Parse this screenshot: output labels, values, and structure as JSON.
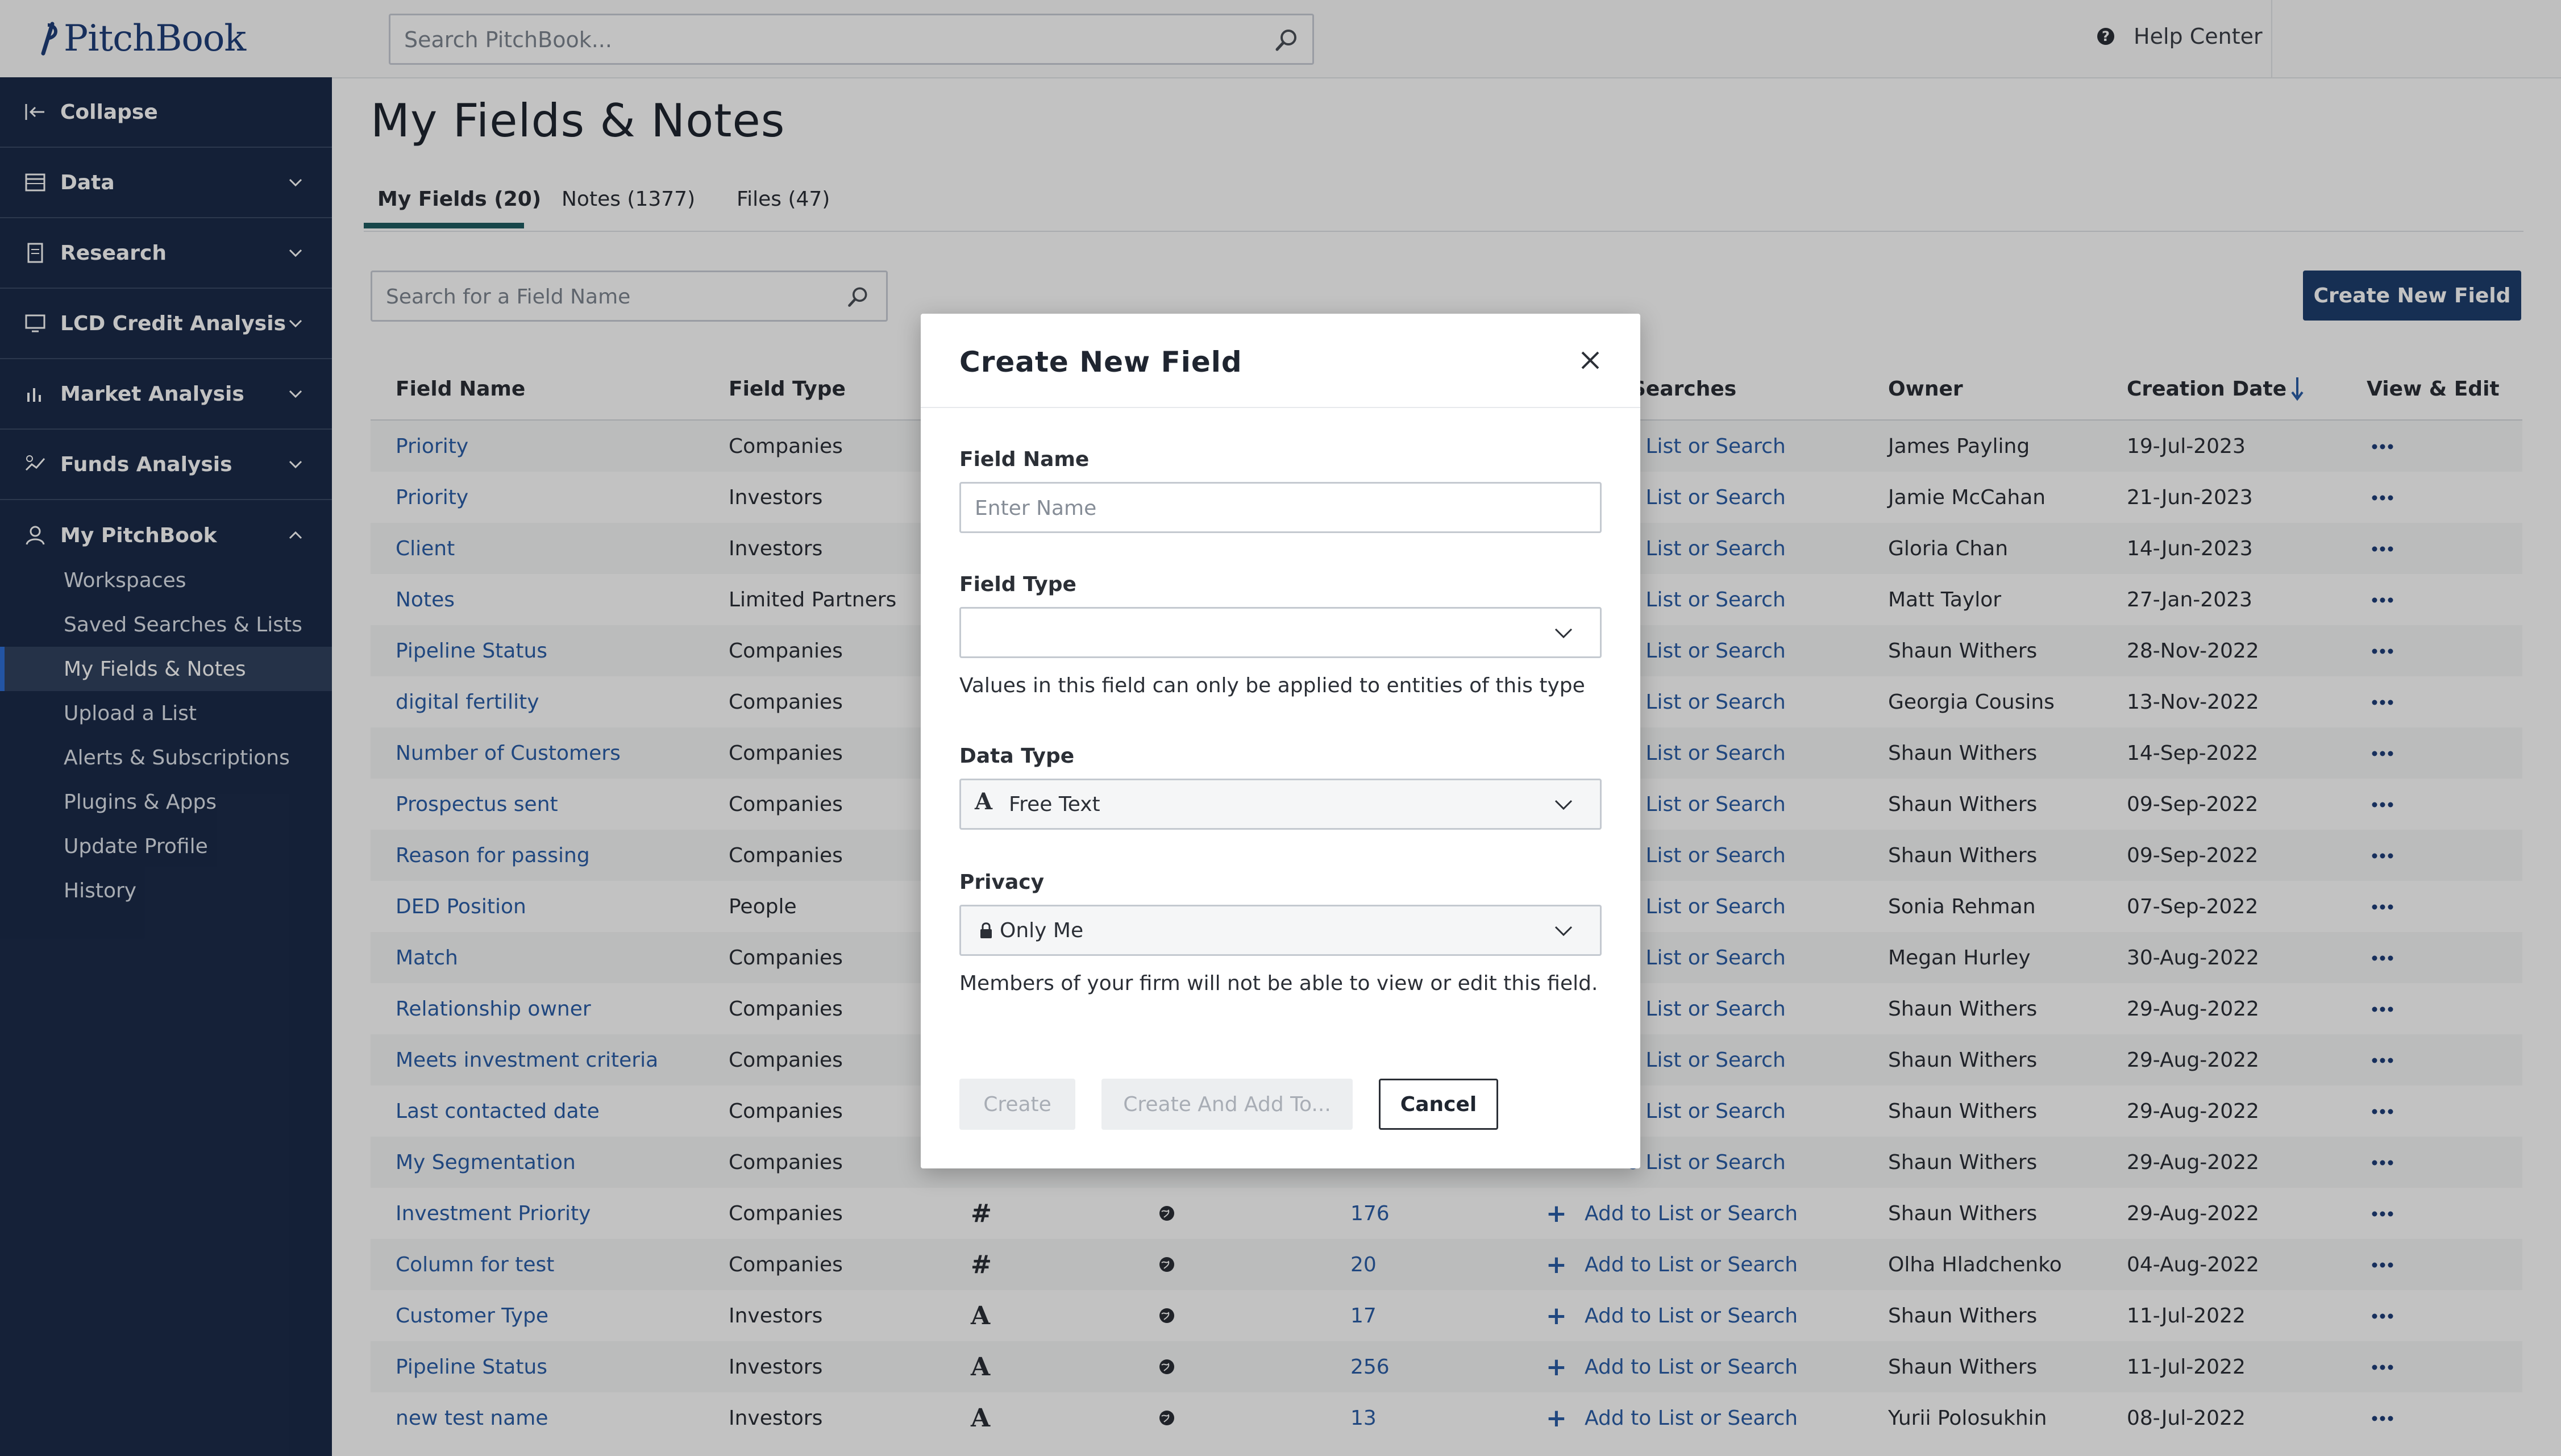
{
  "app": {
    "logo": "PitchBook"
  },
  "header": {
    "search_placeholder": "Search PitchBook...",
    "help_label": "Help Center"
  },
  "sidebar": {
    "collapse": "Collapse",
    "sections": [
      "Data",
      "Research",
      "LCD Credit Analysis",
      "Market Analysis",
      "Funds Analysis",
      "My PitchBook"
    ],
    "subitems": [
      "Workspaces",
      "Saved Searches & Lists",
      "My Fields & Notes",
      "Upload a List",
      "Alerts & Subscriptions",
      "Plugins & Apps",
      "Update Profile",
      "History"
    ],
    "active_subitem": "My Fields & Notes"
  },
  "main": {
    "title": "My Fields & Notes",
    "tabs": [
      "My Fields (20)",
      "Notes (1377)",
      "Files (47)"
    ],
    "active_tab": "My Fields (20)",
    "field_search_placeholder": "Search for a Field Name",
    "create_button": "Create New Field"
  },
  "table": {
    "headers": {
      "name": "Field Name",
      "type": "Field Type",
      "searches": "Searches",
      "owner": "Owner",
      "date": "Creation Date",
      "view": "View & Edit"
    },
    "rows": [
      {
        "name": "Priority",
        "type": "Companies",
        "action": "o List or Search",
        "owner": "James Payling",
        "date": "19-Jul-2023"
      },
      {
        "name": "Priority",
        "type": "Investors",
        "action": "o List or Search",
        "owner": "Jamie McCahan",
        "date": "21-Jun-2023"
      },
      {
        "name": "Client",
        "type": "Investors",
        "action": "o List or Search",
        "owner": "Gloria Chan",
        "date": "14-Jun-2023"
      },
      {
        "name": "Notes",
        "type": "Limited Partners",
        "action": "o List or Search",
        "owner": "Matt Taylor",
        "date": "27-Jan-2023"
      },
      {
        "name": "Pipeline Status",
        "type": "Companies",
        "action": "o List or Search",
        "owner": "Shaun Withers",
        "date": "28-Nov-2022"
      },
      {
        "name": "digital fertility",
        "type": "Companies",
        "action": "o List or Search",
        "owner": "Georgia Cousins",
        "date": "13-Nov-2022"
      },
      {
        "name": "Number of Customers",
        "type": "Companies",
        "action": "o List or Search",
        "owner": "Shaun Withers",
        "date": "14-Sep-2022"
      },
      {
        "name": "Prospectus sent",
        "type": "Companies",
        "action": "o List or Search",
        "owner": "Shaun Withers",
        "date": "09-Sep-2022"
      },
      {
        "name": "Reason for passing",
        "type": "Companies",
        "action": "o List or Search",
        "owner": "Shaun Withers",
        "date": "09-Sep-2022"
      },
      {
        "name": "DED Position",
        "type": "People",
        "action": "o List or Search",
        "owner": "Sonia Rehman",
        "date": "07-Sep-2022"
      },
      {
        "name": "Match",
        "type": "Companies",
        "action": "o List or Search",
        "owner": "Megan Hurley",
        "date": "30-Aug-2022"
      },
      {
        "name": "Relationship owner",
        "type": "Companies",
        "action": "o List or Search",
        "owner": "Shaun Withers",
        "date": "29-Aug-2022"
      },
      {
        "name": "Meets investment criteria",
        "type": "Companies",
        "action": "o List or Search",
        "owner": "Shaun Withers",
        "date": "29-Aug-2022"
      },
      {
        "name": "Last contacted date",
        "type": "Companies",
        "action": "o List or Search",
        "owner": "Shaun Withers",
        "date": "29-Aug-2022"
      },
      {
        "name": "My Segmentation",
        "type": "Companies",
        "action": "o List or Search",
        "owner": "Shaun Withers",
        "date": "29-Aug-2022"
      },
      {
        "name": "Investment Priority",
        "type": "Companies",
        "datatype": "#",
        "count": "176",
        "action": "Add to List or Search",
        "owner": "Shaun Withers",
        "date": "29-Aug-2022"
      },
      {
        "name": "Column for test",
        "type": "Companies",
        "datatype": "#",
        "count": "20",
        "action": "Add to List or Search",
        "owner": "Olha Hladchenko",
        "date": "04-Aug-2022"
      },
      {
        "name": "Customer Type",
        "type": "Investors",
        "datatype": "A",
        "count": "17",
        "action": "Add to List or Search",
        "owner": "Shaun Withers",
        "date": "11-Jul-2022"
      },
      {
        "name": "Pipeline Status",
        "type": "Investors",
        "datatype": "A",
        "count": "256",
        "action": "Add to List or Search",
        "owner": "Shaun Withers",
        "date": "11-Jul-2022"
      },
      {
        "name": "new test name",
        "type": "Investors",
        "datatype": "A",
        "count": "13",
        "action": "Add to List or Search",
        "owner": "Yurii Polosukhin",
        "date": "08-Jul-2022"
      }
    ]
  },
  "modal": {
    "title": "Create New Field",
    "field_name_label": "Field Name",
    "field_name_placeholder": "Enter Name",
    "field_type_label": "Field Type",
    "field_type_value": "",
    "field_type_help": "Values in this field can only be applied to entities of this type",
    "data_type_label": "Data Type",
    "data_type_value": "Free Text",
    "privacy_label": "Privacy",
    "privacy_value": "Only Me",
    "privacy_help": "Members of your firm will not be able to view or edit this field.",
    "buttons": {
      "create": "Create",
      "create_add": "Create And Add To...",
      "cancel": "Cancel"
    }
  }
}
